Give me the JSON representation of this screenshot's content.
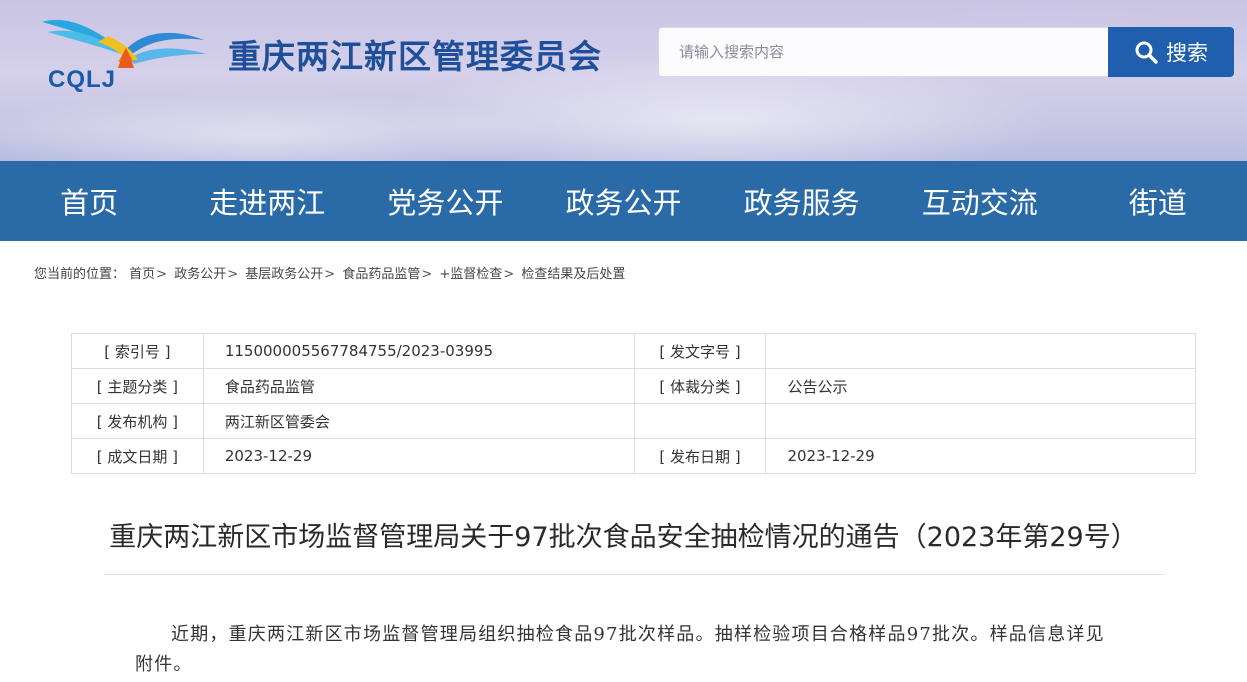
{
  "header": {
    "logo_text": "CQLJ",
    "site_title": "重庆两江新区管理委员会",
    "search": {
      "placeholder": "请输入搜索内容",
      "button_label": "搜索"
    }
  },
  "nav": {
    "items": [
      {
        "label": "首页"
      },
      {
        "label": "走进两江"
      },
      {
        "label": "党务公开"
      },
      {
        "label": "政务公开"
      },
      {
        "label": "政务服务"
      },
      {
        "label": "互动交流"
      },
      {
        "label": "街道"
      }
    ]
  },
  "breadcrumb": {
    "prefix": "您当前的位置：",
    "items": [
      "首页",
      "政务公开",
      "基层政务公开",
      "食品药品监管",
      "+监督检查",
      "检查结果及后处置"
    ],
    "separator": ">"
  },
  "meta": {
    "rows": [
      {
        "k1": "[ 索引号 ]",
        "v1": "115000005567784755/2023-03995",
        "k2": "[ 发文字号 ]",
        "v2": ""
      },
      {
        "k1": "[ 主题分类 ]",
        "v1": "食品药品监管",
        "k2": "[ 体裁分类 ]",
        "v2": "公告公示"
      },
      {
        "k1": "[ 发布机构 ]",
        "v1": "两江新区管委会",
        "k2": "",
        "v2": ""
      },
      {
        "k1": "[ 成文日期 ]",
        "v1": "2023-12-29",
        "k2": "[ 发布日期 ]",
        "v2": "2023-12-29"
      }
    ]
  },
  "article": {
    "title": "重庆两江新区市场监督管理局关于97批次食品安全抽检情况的通告（2023年第29号）",
    "body": "近期，重庆两江新区市场监督管理局组织抽检食品97批次样品。抽样检验项目合格样品97批次。样品信息详见附件。"
  },
  "colors": {
    "nav_bg": "#2a6aa6",
    "search_button_bg": "#1f5fae",
    "title_blue": "#1f4f9a"
  }
}
